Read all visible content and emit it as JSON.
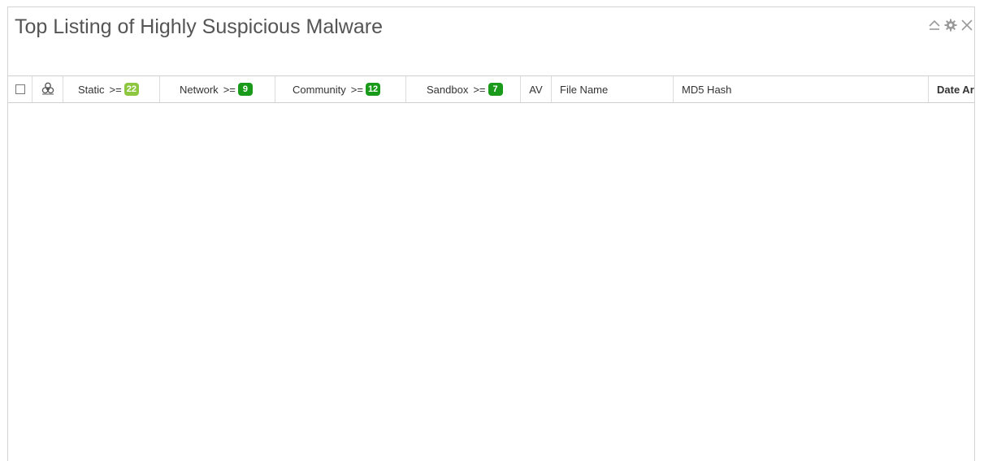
{
  "panel": {
    "title": "Top Listing of Highly Suspicious Malware",
    "controls": [
      {
        "name": "collapse",
        "icon": "chevron-up-icon"
      },
      {
        "name": "settings",
        "icon": "gear-icon"
      },
      {
        "name": "close",
        "icon": "close-icon"
      }
    ]
  },
  "grid": {
    "select_all_checked": false,
    "biohazard_icon": "biohazard-icon",
    "columns": {
      "static": {
        "label": "Static",
        "op": ">=",
        "badge": "22",
        "badge_color": "#8dc63f"
      },
      "network": {
        "label": "Network",
        "op": ">=",
        "badge": "9",
        "badge_color": "#1a9a1a"
      },
      "community": {
        "label": "Community",
        "op": ">=",
        "badge": "12",
        "badge_color": "#1a9a1a"
      },
      "sandbox": {
        "label": "Sandbox",
        "op": ">=",
        "badge": "7",
        "badge_color": "#1a9a1a"
      },
      "av": {
        "label": "AV"
      },
      "file_name": {
        "label": "File Name"
      },
      "md5_hash": {
        "label": "MD5 Hash"
      },
      "date_arrived": {
        "label": "Date Arc"
      }
    },
    "rows": []
  }
}
